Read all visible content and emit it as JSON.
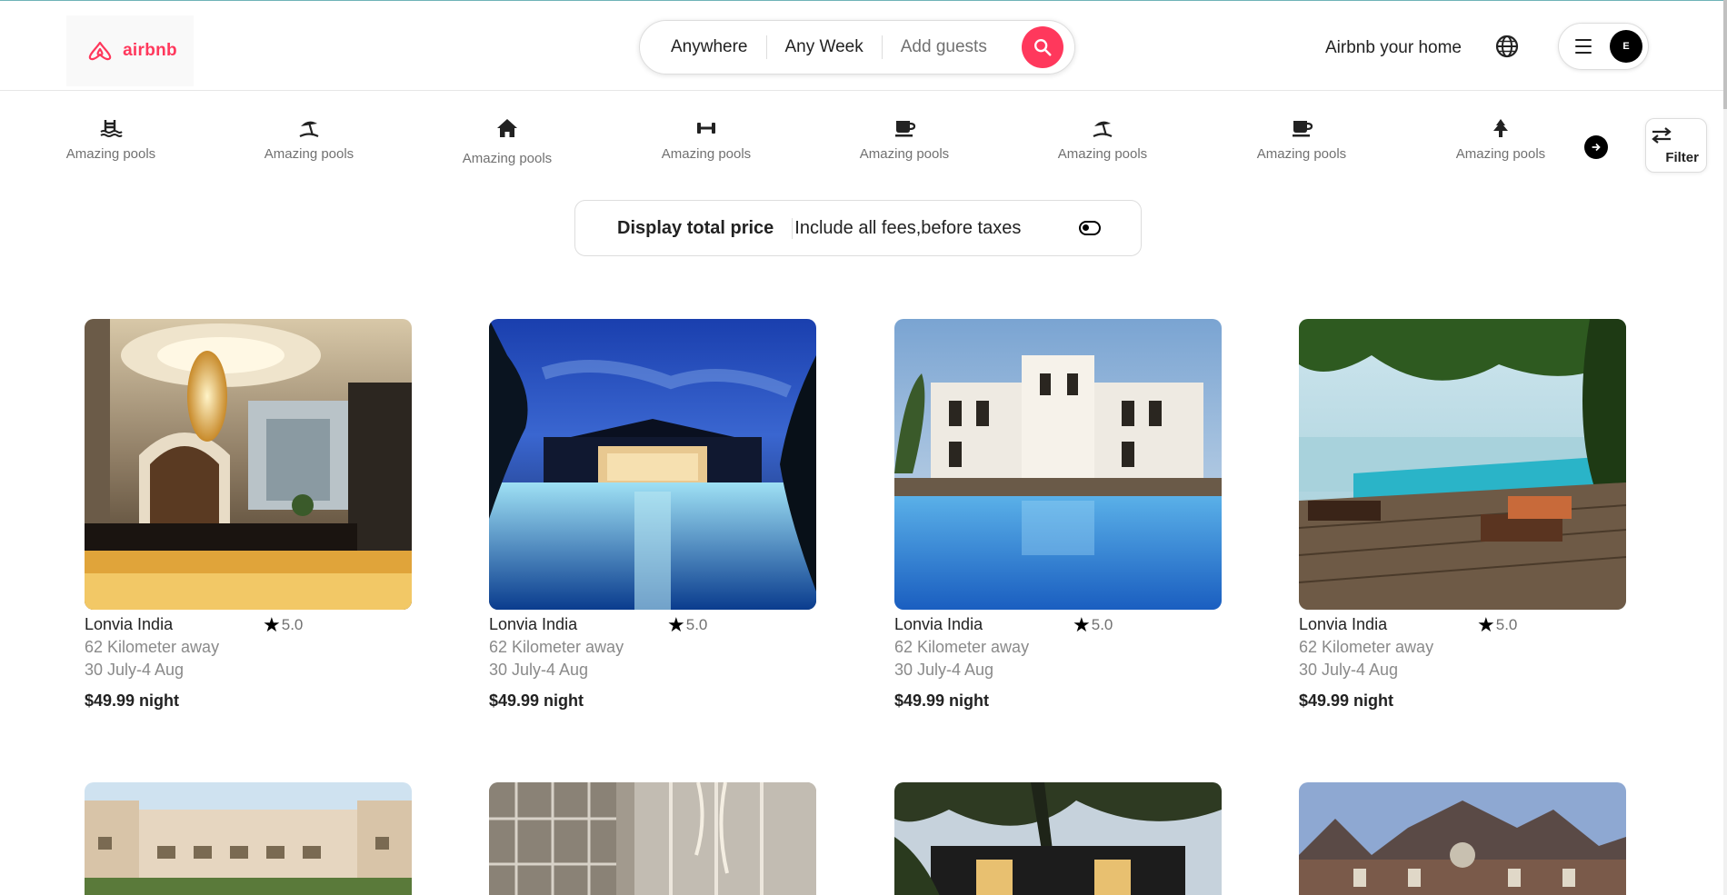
{
  "header": {
    "logo_text": "airbnb",
    "search": {
      "where": "Anywhere",
      "when": "Any Week",
      "who": "Add guests"
    },
    "host_link": "Airbnb your home",
    "avatar_initial": "E"
  },
  "categories": [
    {
      "label": "Amazing pools",
      "icon": "pool-icon"
    },
    {
      "label": "Amazing pools",
      "icon": "beach-umbrella-icon"
    },
    {
      "label": "Amazing pools",
      "icon": "house-icon"
    },
    {
      "label": "Amazing pools",
      "icon": "dumbbell-icon"
    },
    {
      "label": "Amazing pools",
      "icon": "coffee-cup-icon"
    },
    {
      "label": "Amazing pools",
      "icon": "beach-umbrella-icon"
    },
    {
      "label": "Amazing pools",
      "icon": "coffee-cup-icon"
    },
    {
      "label": "Amazing pools",
      "icon": "tree-icon"
    }
  ],
  "filter_label": "Filter",
  "price_toggle": {
    "title": "Display total price",
    "description": "Include all fees,before taxes"
  },
  "listings": [
    {
      "title": "Lonvia India",
      "rating": "5.0",
      "distance": "62 Kilometer away",
      "dates": "30 July-4 Aug",
      "price": "$49.99 night",
      "photo": "hotel-lobby"
    },
    {
      "title": "Lonvia India",
      "rating": "5.0",
      "distance": "62 Kilometer away",
      "dates": "30 July-4 Aug",
      "price": "$49.99 night",
      "photo": "night-pool"
    },
    {
      "title": "Lonvia India",
      "rating": "5.0",
      "distance": "62 Kilometer away",
      "dates": "30 July-4 Aug",
      "price": "$49.99 night",
      "photo": "villa-pool"
    },
    {
      "title": "Lonvia India",
      "rating": "5.0",
      "distance": "62 Kilometer away",
      "dates": "30 July-4 Aug",
      "price": "$49.99 night",
      "photo": "beach-deck"
    }
  ],
  "listings_row2": [
    {
      "photo": "resort-building"
    },
    {
      "photo": "atrium"
    },
    {
      "photo": "modern-house"
    },
    {
      "photo": "brick-mansion"
    }
  ],
  "colors": {
    "brand": "#ff385c",
    "muted_text": "#8a8a8a",
    "border": "#dddddd"
  }
}
